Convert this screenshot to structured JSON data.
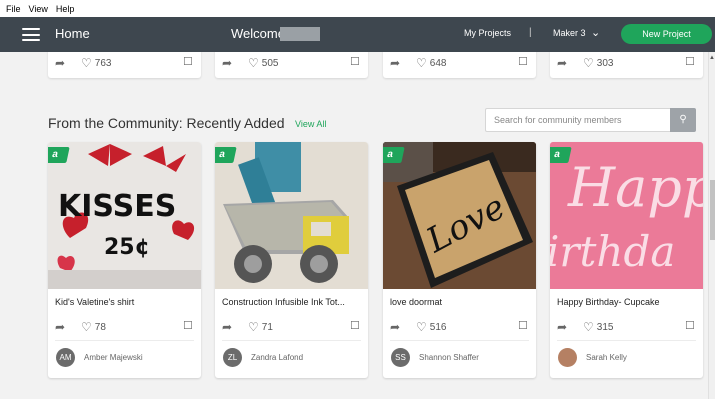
{
  "menu": [
    "File",
    "View",
    "Help"
  ],
  "topbar": {
    "home": "Home",
    "welcome": "Welcome,",
    "my_projects": "My Projects",
    "separator": "|",
    "machine": "Maker 3",
    "new_project": "New Project"
  },
  "top_cards": [
    {
      "likes": "763"
    },
    {
      "likes": "505"
    },
    {
      "likes": "648"
    },
    {
      "likes": "303"
    }
  ],
  "section": {
    "title": "From the Community: Recently Added",
    "view_all": "View All",
    "search_placeholder": "Search for community members"
  },
  "cards": [
    {
      "title": "Kid's Valetine's shirt",
      "likes": "78",
      "user": "Amber Majewski",
      "initials": "AM",
      "image_text": "KISSES 25¢"
    },
    {
      "title": "Construction Infusible Ink Tot...",
      "likes": "71",
      "user": "Zandra Lafond",
      "initials": "ZL"
    },
    {
      "title": "love doormat",
      "likes": "516",
      "user": "Shannon Shaffer",
      "initials": "SS",
      "image_text": "Love"
    },
    {
      "title": "Happy Birthday- Cupcake",
      "likes": "315",
      "user": "Sarah Kelly",
      "initials": "",
      "image_text": "Happy Birthday"
    }
  ],
  "badge": "a",
  "colors": {
    "accent": "#1fa55b",
    "topbar": "#3e474f",
    "background": "#f2f2f2"
  },
  "icons": [
    "hamburger-icon",
    "chevron-down-icon",
    "search-icon",
    "share-icon",
    "heart-icon",
    "bookmark-icon"
  ]
}
